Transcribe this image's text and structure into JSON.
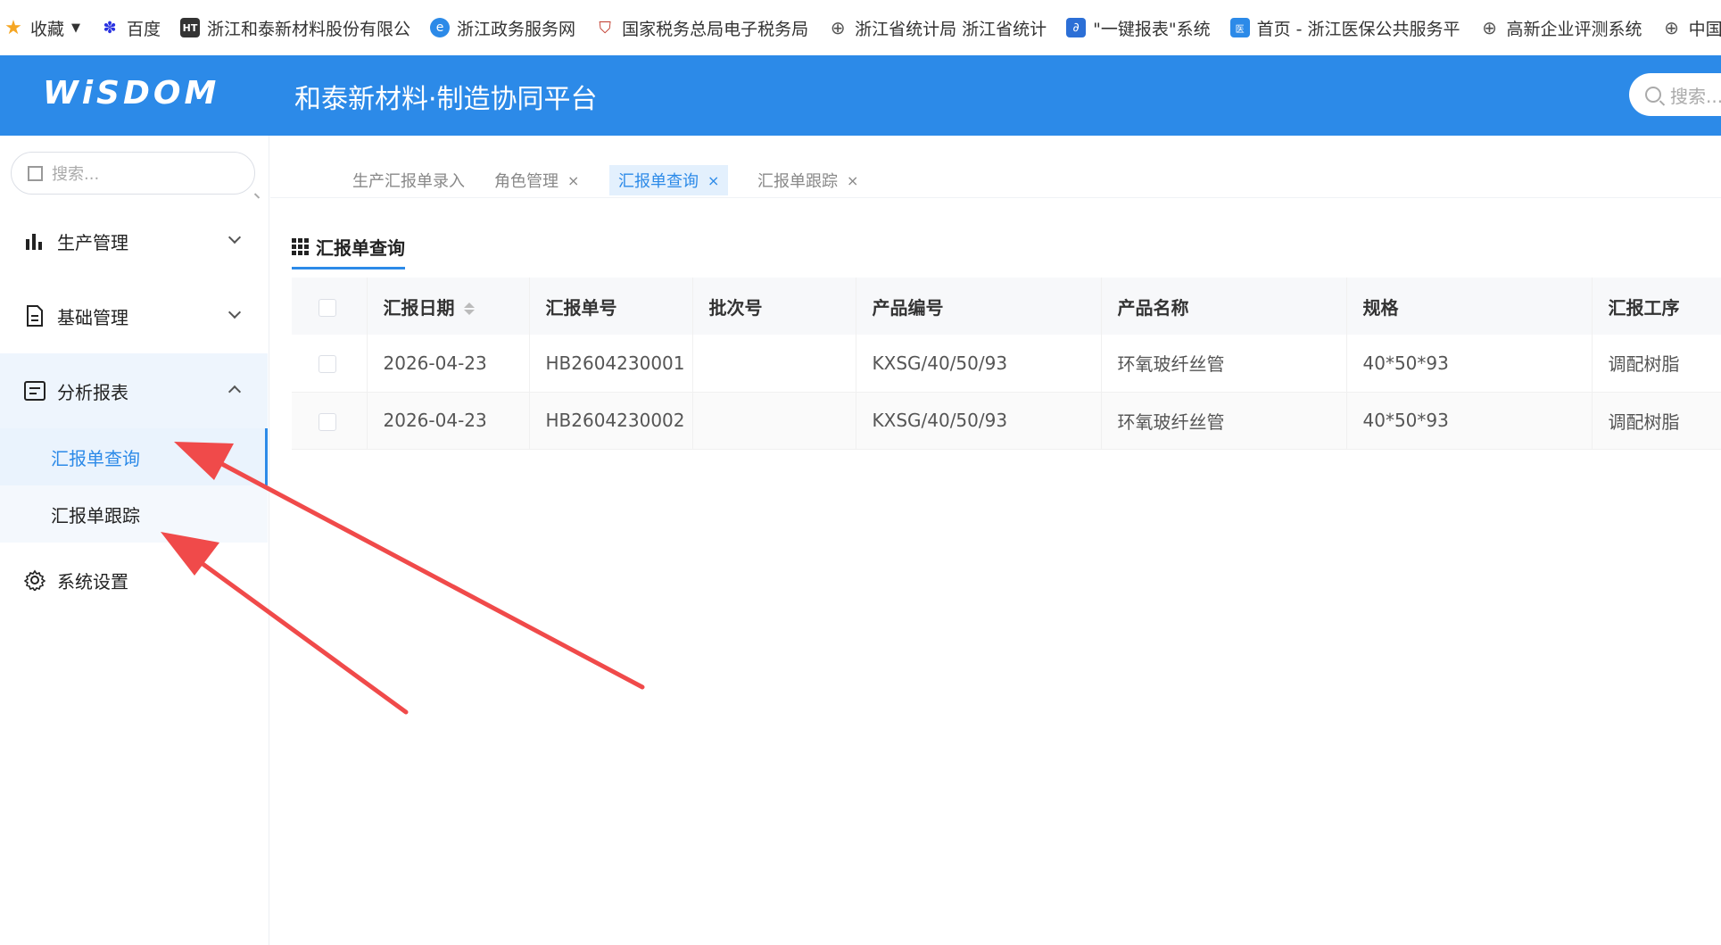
{
  "bookmarks": [
    {
      "label": "收藏",
      "icon": "star-icon",
      "color": "#f5a623"
    },
    {
      "label": "百度",
      "icon": "baidu-paw-icon",
      "color": "#2932e1"
    },
    {
      "label": "浙江和泰新材料股份有限公",
      "icon": "company-logo-icon",
      "color": "#333333"
    },
    {
      "label": "浙江政务服务网",
      "icon": "zj-gov-icon",
      "color": "#2c8ae8"
    },
    {
      "label": "国家税务总局电子税务局",
      "icon": "tax-emblem-icon",
      "color": "#c0392b"
    },
    {
      "label": "浙江省统计局 浙江省统计",
      "icon": "globe-icon",
      "color": "#555555"
    },
    {
      "label": "\"一键报表\"系统",
      "icon": "report-system-icon",
      "color": "#2c6fd6"
    },
    {
      "label": "首页 - 浙江医保公共服务平",
      "icon": "medical-insurance-icon",
      "color": "#2c8ae8"
    },
    {
      "label": "高新企业评测系统",
      "icon": "globe-icon",
      "color": "#555555"
    },
    {
      "label": "中国电子口岸",
      "icon": "globe-icon",
      "color": "#555555"
    }
  ],
  "header": {
    "logo": "WiSDOM",
    "title": "和泰新材料·制造协同平台",
    "search_placeholder": "搜索..."
  },
  "sidebar": {
    "search_placeholder": "搜索...",
    "items": [
      {
        "label": "生产管理",
        "icon": "bar-chart-icon",
        "expanded": false
      },
      {
        "label": "基础管理",
        "icon": "document-icon",
        "expanded": false
      },
      {
        "label": "分析报表",
        "icon": "report-icon",
        "expanded": true,
        "children": [
          {
            "label": "汇报单查询",
            "active": true
          },
          {
            "label": "汇报单跟踪",
            "active": false
          }
        ]
      },
      {
        "label": "系统设置",
        "icon": "gear-icon",
        "expanded": false
      }
    ]
  },
  "tabs": [
    {
      "label": "生产汇报单录入",
      "closable": false,
      "active": false
    },
    {
      "label": "角色管理",
      "closable": true,
      "active": false
    },
    {
      "label": "汇报单查询",
      "closable": true,
      "active": true
    },
    {
      "label": "汇报单跟踪",
      "closable": true,
      "active": false
    }
  ],
  "tab_close_glyph": "×",
  "panel": {
    "title": "汇报单查询"
  },
  "table": {
    "columns": [
      "汇报日期",
      "汇报单号",
      "批次号",
      "产品编号",
      "产品名称",
      "规格",
      "汇报工序"
    ],
    "rows": [
      [
        "2026-04-23",
        "HB2604230001",
        "",
        "KXSG/40/50/93",
        "环氧玻纤丝管",
        "40*50*93",
        "调配树脂"
      ],
      [
        "2026-04-23",
        "HB2604230002",
        "",
        "KXSG/40/50/93",
        "环氧玻纤丝管",
        "40*50*93",
        "调配树脂"
      ]
    ]
  },
  "colors": {
    "primary": "#2c8ae8",
    "annotation_arrow": "#f04a4a"
  }
}
